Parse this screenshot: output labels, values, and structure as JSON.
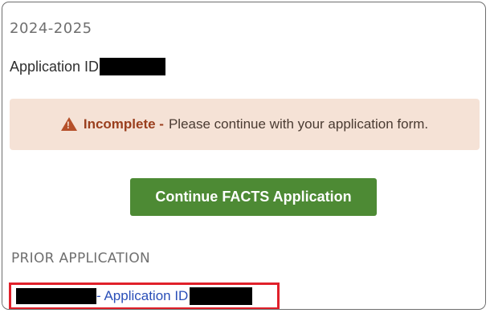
{
  "application": {
    "year": "2024-2025",
    "id_label": "Application ID"
  },
  "alert": {
    "icon": "warning-icon",
    "status": "Incomplete -",
    "message": "Please continue with your application form.",
    "colors": {
      "background": "#f5e2d6",
      "status": "#9a3f1e"
    }
  },
  "actions": {
    "continue_label": "Continue FACTS Application",
    "continue_color": "#4d8a34"
  },
  "prior": {
    "heading": "PRIOR APPLICATION",
    "link_text": "- Application ID",
    "highlight_color": "#e0202a",
    "link_color": "#2a4fb8"
  }
}
